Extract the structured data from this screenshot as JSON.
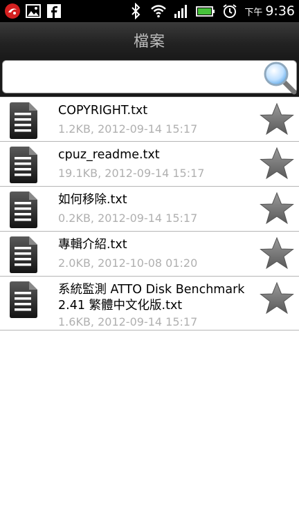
{
  "status_bar": {
    "ampm": "下午",
    "time": "9:36",
    "icons": [
      "app-notification-icon",
      "image-icon",
      "facebook-icon",
      "bluetooth-icon",
      "wifi-icon",
      "signal-icon",
      "battery-icon",
      "alarm-icon"
    ]
  },
  "header": {
    "title": "檔案"
  },
  "search": {
    "value": "",
    "placeholder": ""
  },
  "files": [
    {
      "name": "COPYRIGHT.txt",
      "meta": "1.2KB, 2012-09-14 15:17"
    },
    {
      "name": "cpuz_readme.txt",
      "meta": "19.1KB, 2012-09-14 15:17"
    },
    {
      "name": "如何移除.txt",
      "meta": "0.2KB, 2012-09-14 15:17"
    },
    {
      "name": "專輯介紹.txt",
      "meta": "2.0KB, 2012-10-08 01:20"
    },
    {
      "name": "系統監測  ATTO Disk Benchmark 2.41 繁體中文化版.txt",
      "meta": "1.6KB, 2012-09-14 15:17"
    }
  ],
  "colors": {
    "accent_battery": "#46c23a",
    "star": "#7a7a7a",
    "meta_text": "#b0b0b0"
  }
}
